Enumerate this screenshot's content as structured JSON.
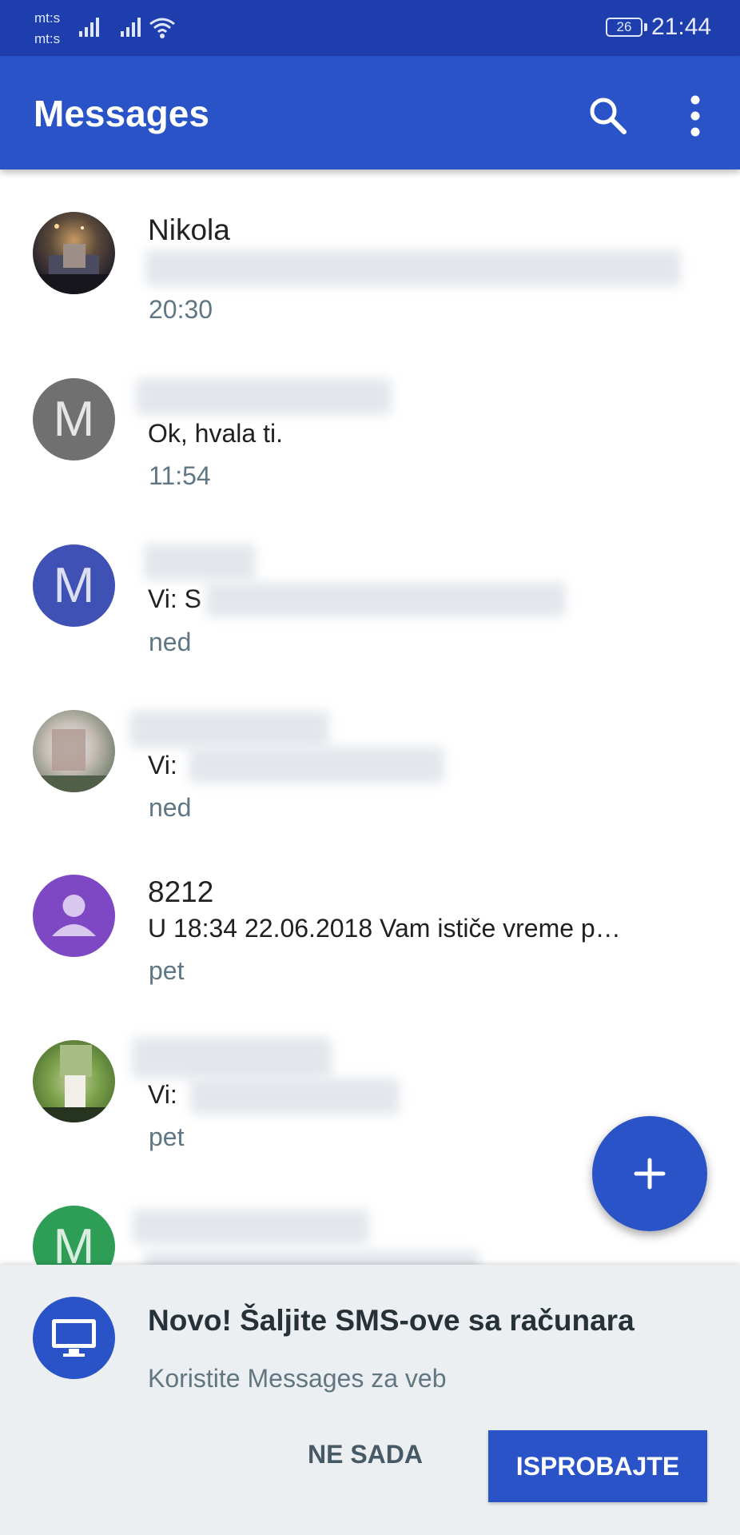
{
  "status_bar": {
    "carrier_top": "mt:s",
    "carrier_bottom": "mt:s",
    "battery": "26",
    "time": "21:44"
  },
  "app_bar": {
    "title": "Messages",
    "search_icon": "search-icon",
    "more_icon": "more-vert-icon"
  },
  "conversations": [
    {
      "name": "Nikola",
      "snippet": "",
      "time": "20:30",
      "avatar_type": "photo",
      "avatar_color": "#2e2a3c"
    },
    {
      "name": "",
      "snippet": "Ok, hvala ti.",
      "time": "11:54",
      "avatar_letter": "M",
      "avatar_color": "#707070"
    },
    {
      "name": "",
      "snippet": "Vi: S",
      "time": "ned",
      "avatar_letter": "M",
      "avatar_color": "#3f51b5"
    },
    {
      "name": "",
      "snippet": "Vi:",
      "time": "ned",
      "avatar_type": "photo",
      "avatar_color": "#b7a59b"
    },
    {
      "name": "8212",
      "snippet": "U 18:34 22.06.2018 Vam ističe vreme p…",
      "time": "pet",
      "avatar_type": "person-icon",
      "avatar_color": "#7e47c3"
    },
    {
      "name": "",
      "snippet": "Vi:",
      "time": "pet",
      "avatar_type": "photo",
      "avatar_color": "#6f8f3f"
    },
    {
      "name": "",
      "snippet": "",
      "time": "",
      "avatar_letter": "M",
      "avatar_color": "#2e9e57"
    }
  ],
  "fab": {
    "icon": "plus-icon"
  },
  "promo": {
    "title": "Novo! Šaljite SMS-ove sa računara",
    "subtitle": "Koristite Messages za veb",
    "dismiss_label": "NE SADA",
    "try_label": "ISPROBAJTE",
    "icon": "monitor-icon"
  }
}
